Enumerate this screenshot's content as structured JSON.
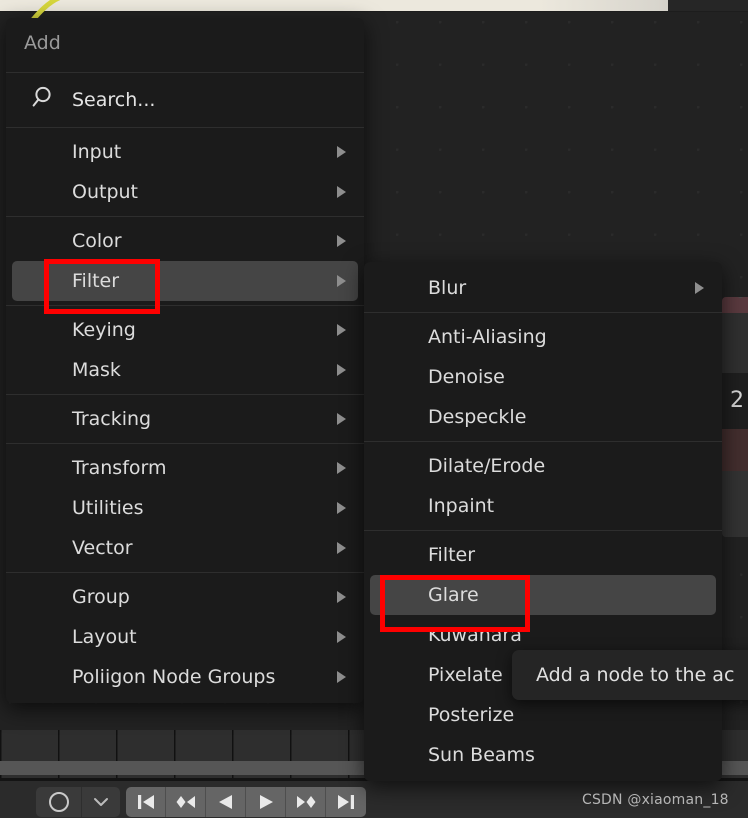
{
  "app": {
    "editor": "blender-compositor-node-editor",
    "watermark": "CSDN @xiaoman_18"
  },
  "colors": {
    "menu_background": "#1b1b1b",
    "menu_highlight": "#454545",
    "annotation_red": "#fe0000",
    "text_primary": "#dcdcdc",
    "text_muted": "#9a9a9a",
    "node_header_red": "#5a3a3f",
    "noodle_yellow": "#d6d63c",
    "canvas": "#222222"
  },
  "add_menu": {
    "title": "Add",
    "search": {
      "label": "Search...",
      "icon": "search-icon"
    },
    "groups": [
      {
        "items": [
          {
            "label": "Input",
            "submenu": true,
            "highlighted": false
          },
          {
            "label": "Output",
            "submenu": true,
            "highlighted": false
          }
        ]
      },
      {
        "items": [
          {
            "label": "Color",
            "submenu": true,
            "highlighted": false
          },
          {
            "label": "Filter",
            "submenu": true,
            "highlighted": true
          }
        ]
      },
      {
        "items": [
          {
            "label": "Keying",
            "submenu": true,
            "highlighted": false
          },
          {
            "label": "Mask",
            "submenu": true,
            "highlighted": false
          }
        ]
      },
      {
        "items": [
          {
            "label": "Tracking",
            "submenu": true,
            "highlighted": false
          }
        ]
      },
      {
        "items": [
          {
            "label": "Transform",
            "submenu": true,
            "highlighted": false
          },
          {
            "label": "Utilities",
            "submenu": true,
            "highlighted": false
          },
          {
            "label": "Vector",
            "submenu": true,
            "highlighted": false
          }
        ]
      },
      {
        "items": [
          {
            "label": "Group",
            "submenu": true,
            "highlighted": false
          },
          {
            "label": "Layout",
            "submenu": true,
            "highlighted": false
          },
          {
            "label": "Poliigon Node Groups",
            "submenu": true,
            "highlighted": false
          }
        ]
      }
    ]
  },
  "filter_submenu": {
    "groups": [
      {
        "items": [
          {
            "label": "Blur",
            "submenu": true,
            "highlighted": false
          }
        ]
      },
      {
        "items": [
          {
            "label": "Anti-Aliasing",
            "submenu": false,
            "highlighted": false
          },
          {
            "label": "Denoise",
            "submenu": false,
            "highlighted": false
          },
          {
            "label": "Despeckle",
            "submenu": false,
            "highlighted": false
          }
        ]
      },
      {
        "items": [
          {
            "label": "Dilate/Erode",
            "submenu": false,
            "highlighted": false
          },
          {
            "label": "Inpaint",
            "submenu": false,
            "highlighted": false
          }
        ]
      },
      {
        "items": [
          {
            "label": "Filter",
            "submenu": false,
            "highlighted": false
          },
          {
            "label": "Glare",
            "submenu": false,
            "highlighted": true
          },
          {
            "label": "Kuwahara",
            "submenu": false,
            "highlighted": false
          },
          {
            "label": "Pixelate",
            "submenu": false,
            "highlighted": false
          },
          {
            "label": "Posterize",
            "submenu": false,
            "highlighted": false
          },
          {
            "label": "Sun Beams",
            "submenu": false,
            "highlighted": false
          }
        ]
      }
    ]
  },
  "tooltip": {
    "text": "Add a node to the ac"
  },
  "edge_node": {
    "number": "2"
  },
  "timeline": {
    "buttons": [
      {
        "name": "record-button",
        "icon": "record-circle-icon"
      },
      {
        "name": "record-options-button",
        "icon": "chevron-down-icon"
      },
      {
        "name": "jump-to-start-button",
        "icon": "jump-start-icon"
      },
      {
        "name": "prev-keyframe-button",
        "icon": "prev-keyframe-icon"
      },
      {
        "name": "play-reverse-button",
        "icon": "play-reverse-icon"
      },
      {
        "name": "play-button",
        "icon": "play-icon"
      },
      {
        "name": "next-keyframe-button",
        "icon": "next-keyframe-icon"
      },
      {
        "name": "jump-to-end-button",
        "icon": "jump-end-icon"
      }
    ]
  },
  "annotations": [
    {
      "name": "redbox-filter",
      "target": "Filter"
    },
    {
      "name": "redbox-glare",
      "target": "Glare"
    }
  ]
}
